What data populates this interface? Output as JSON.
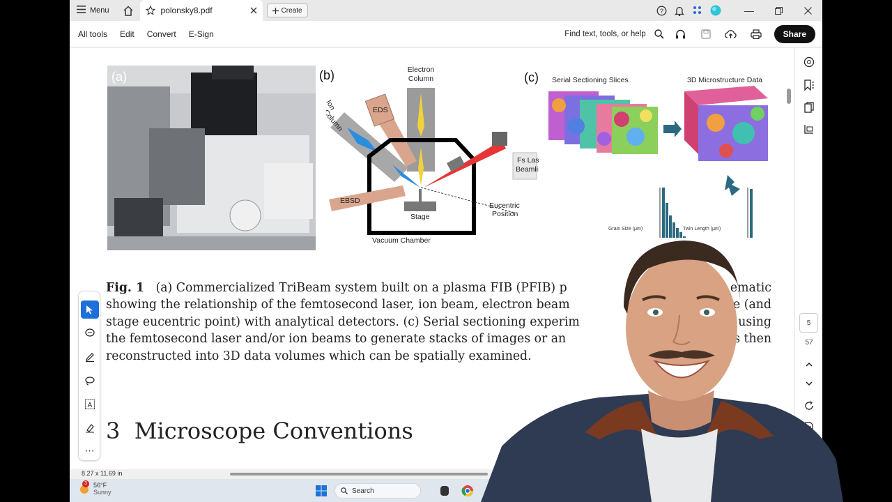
{
  "titlebar": {
    "menu_label": "Menu",
    "tab_title": "polonsky8.pdf",
    "create_label": "Create"
  },
  "toolbar": {
    "items": [
      "All tools",
      "Edit",
      "Convert",
      "E-Sign"
    ],
    "find_placeholder": "Find text, tools, or help",
    "share_label": "Share"
  },
  "document": {
    "figure": {
      "panel_a": "(a)",
      "panel_b": "(b)",
      "panel_c": "(c)",
      "b_labels": {
        "electron_column_1": "Electron",
        "electron_column_2": "Column",
        "ion_column_1": "Ion",
        "ion_column_2": "Column",
        "eds": "EDS",
        "fs_laser_1": "Fs Laser",
        "fs_laser_2": "Beamline",
        "ebsd": "EBSD",
        "stage": "Stage",
        "eucentric_1": "Eucentric",
        "eucentric_2": "Position",
        "vacuum": "Vacuum Chamber"
      },
      "c_labels": {
        "serial": "Serial Sectioning Slices",
        "micro": "3D Microstructure Data",
        "hist1_xlabel": "Grain Size (μm)",
        "hist2_xlabel": "Twin Length (μm)"
      }
    },
    "caption_fig": "Fig. 1",
    "caption_text": "(a) Commercialized TriBeam system built on a plasma FIB (PFIB) p",
    "caption_text_tail": "ematic",
    "caption_line2": "showing the relationship of the femtosecond laser, ion beam, electron beam",
    "caption_line2_tail": "ge (and",
    "caption_line3": "stage eucentric point) with analytical detectors. (c) Serial sectioning experim",
    "caption_line3_tail": "d using",
    "caption_line4": "the femtosecond laser and/or ion beams to generate stacks of images or an",
    "caption_line4_tail": "is then",
    "caption_line5": "reconstructed into 3D data volumes which can be spatially examined.",
    "section_number": "3",
    "section_title": "Microscope Conventions"
  },
  "rightrail": {
    "page_current": "5",
    "page_total": "57"
  },
  "statusbar": {
    "dimensions": "8.27 x 11.69 in"
  },
  "taskbar": {
    "weather_badge": "3",
    "temperature": "56°F",
    "condition": "Sunny",
    "search_label": "Search"
  }
}
